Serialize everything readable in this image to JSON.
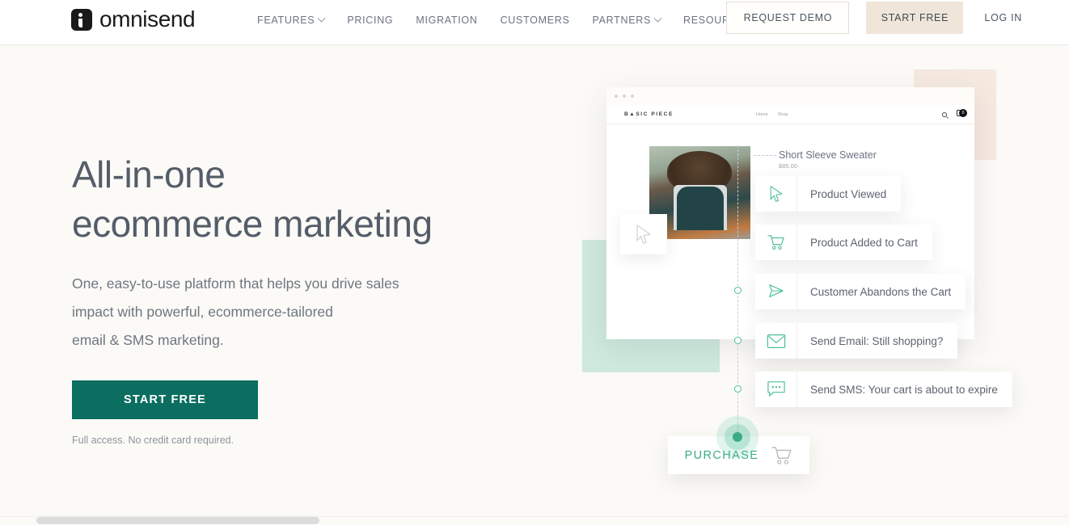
{
  "header": {
    "brand": {
      "name": "omnisend",
      "icon": "omnisend-logo-icon"
    },
    "nav": [
      {
        "label": "FEATURES",
        "has_dropdown": true
      },
      {
        "label": "PRICING",
        "has_dropdown": false
      },
      {
        "label": "MIGRATION",
        "has_dropdown": false
      },
      {
        "label": "CUSTOMERS",
        "has_dropdown": false
      },
      {
        "label": "PARTNERS",
        "has_dropdown": true
      },
      {
        "label": "RESOURCES",
        "has_dropdown": true
      }
    ],
    "request_demo": "REQUEST DEMO",
    "start_free": "START FREE",
    "log_in": "LOG IN"
  },
  "hero": {
    "title_line1": "All-in-one",
    "title_line2": "ecommerce marketing",
    "subtitle_line1": "One, easy-to-use platform that helps you drive sales",
    "subtitle_line2": "impact with powerful, ecommerce-tailored",
    "subtitle_line3": "email & SMS marketing.",
    "cta_label": "START FREE",
    "cta_note": "Full access. No credit card required."
  },
  "mockup": {
    "store_logo": "B▲SIC PIECE",
    "nav_links": [
      "Home",
      "Shop"
    ],
    "cart_count": "0",
    "product_title": "Short Sleeve Sweater",
    "product_price": "$85.00",
    "search_icon": "search-icon",
    "cart_icon": "cart-icon"
  },
  "workflow": {
    "cards": [
      {
        "label": "Product Viewed",
        "icon": "cursor-pointer-icon"
      },
      {
        "label": "Product Added to Cart",
        "icon": "shopping-cart-icon"
      },
      {
        "label": "Customer Abandons the Cart",
        "icon": "paper-plane-icon"
      },
      {
        "label": "Send Email: Still shopping?",
        "icon": "envelope-icon"
      },
      {
        "label": "Send SMS: Your cart is about to expire",
        "icon": "chat-bubble-icon"
      }
    ],
    "purchase_label": "PURCHASE",
    "purchase_icon": "shopping-cart-icon"
  },
  "colors": {
    "page_background": "#fbfaf6",
    "accent_green": "#0b6e60",
    "flow_green": "#3bab88",
    "header_cta_beige": "#efe6d9",
    "shape_peach": "#f6e9e0",
    "shape_mint": "#cfe9dd",
    "heading_gray": "#545d69"
  }
}
